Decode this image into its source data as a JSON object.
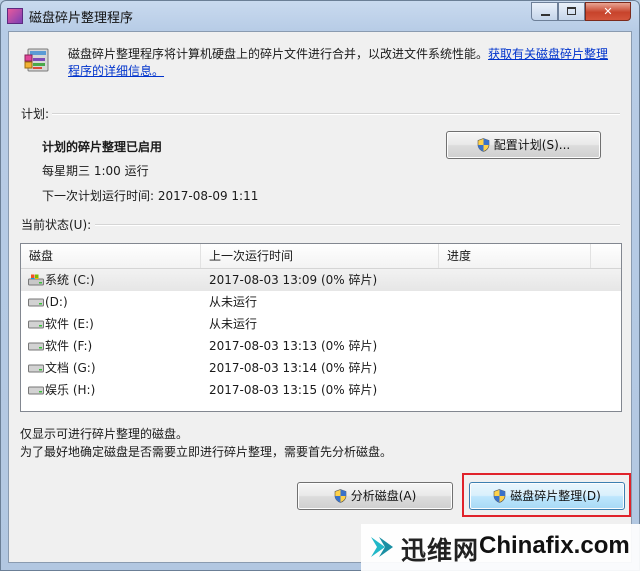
{
  "window": {
    "title": "磁盘碎片整理程序",
    "close_glyph": "✕"
  },
  "intro": {
    "text": "磁盘碎片整理程序将计算机硬盘上的碎片文件进行合并，以改进文件系统性能。",
    "link": "获取有关磁盘碎片整理程序的详细信息。"
  },
  "schedule": {
    "section_label": "计划:",
    "status": "计划的碎片整理已启用",
    "frequency": "每星期三  1:00 运行",
    "next_run": "下一次计划运行时间: 2017-08-09 1:11",
    "config_button": "配置计划(S)..."
  },
  "current_status": {
    "section_label": "当前状态(U):",
    "columns": [
      "磁盘",
      "上一次运行时间",
      "进度"
    ],
    "rows": [
      {
        "disk": "系统 (C:)",
        "last_run": "2017-08-03 13:09 (0% 碎片)",
        "progress": "",
        "icon": "system-drive-icon"
      },
      {
        "disk": "(D:)",
        "last_run": "从未运行",
        "progress": "",
        "icon": "drive-icon"
      },
      {
        "disk": "软件 (E:)",
        "last_run": "从未运行",
        "progress": "",
        "icon": "drive-icon"
      },
      {
        "disk": "软件 (F:)",
        "last_run": "2017-08-03 13:13 (0% 碎片)",
        "progress": "",
        "icon": "drive-icon"
      },
      {
        "disk": "文档 (G:)",
        "last_run": "2017-08-03 13:14 (0% 碎片)",
        "progress": "",
        "icon": "drive-icon"
      },
      {
        "disk": "娱乐 (H:)",
        "last_run": "2017-08-03 13:15 (0% 碎片)",
        "progress": "",
        "icon": "drive-icon"
      }
    ]
  },
  "notes": {
    "line1": "仅显示可进行碎片整理的磁盘。",
    "line2": "为了最好地确定磁盘是否需要立即进行碎片整理，需要首先分析磁盘。"
  },
  "actions": {
    "analyze_button": "分析磁盘(A)",
    "defrag_button": "磁盘碎片整理(D)"
  },
  "watermark": {
    "cn": "迅维网",
    "en": "Chinafix.com"
  },
  "colors": {
    "highlight": "#e0232b",
    "link": "#0033cc",
    "title_gradient_top": "#c9daef"
  }
}
